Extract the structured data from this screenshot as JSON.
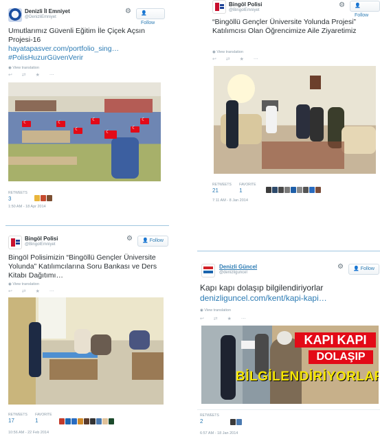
{
  "follow_label": "Follow",
  "view_translation": "View translation",
  "actions": "↩ ⇄ ★ ⋯",
  "tweets": [
    {
      "name": "Denizli İl Emniyet",
      "handle": "@DenizliEmniyet",
      "text": "Umutlarımız Güvenli Eğitim İle Çiçek Açsın Projesi-16",
      "link1": "hayatapasver.com/portfolio_sing…",
      "link2": "#PolisHuzurGüvenVerir",
      "retweets_label": "RETWEETS",
      "retweets": "3",
      "time": "1:50 AM - 18 Apr 2014"
    },
    {
      "name": "Bingöl Polisi",
      "handle": "@BingolEmniyet",
      "text": "“Bingöllü Gençler Üniversite Yolunda Projesi” Katılımcısı Olan Öğrencimize Aile Ziyaretimiz",
      "retweets_label": "RETWEETS",
      "retweets": "21",
      "favorites_label": "FAVORITE",
      "favorites": "1",
      "time": "7:11 AM - 8 Jan 2014"
    },
    {
      "name": "Bingöl Polisi",
      "handle": "@BingolEmniyet",
      "text": "Bingöl Polisimizin “Bingöllü Gençler Üniversite Yolunda” Katılımcılarına Soru Bankası ve  Ders Kitabı Dağıtımı…",
      "retweets_label": "RETWEETS",
      "retweets": "17",
      "favorites_label": "FAVORITE",
      "favorites": "1",
      "time": "10:56 AM - 22 Feb 2014"
    },
    {
      "name": "Denizli Güncel",
      "handle": "@denizliguncel",
      "text": "Kapı kapı dolaşıp bilgilendiriyorlar",
      "link1": "denizliguncel.com/kent/kapi-kapi…",
      "retweets_label": "RETWEETS",
      "retweets": "2",
      "time": "6:57 AM - 18 Jan 2014",
      "banner_line1": "KAPI KAPI",
      "banner_line2": "DOLAŞIP",
      "banner_line3": "BİLGİLENDİRİYORLAR"
    }
  ],
  "colors": {
    "link": "#2a7ab3",
    "muted": "#8899a6",
    "text": "#292f33",
    "flag_red": "#e30a17"
  }
}
